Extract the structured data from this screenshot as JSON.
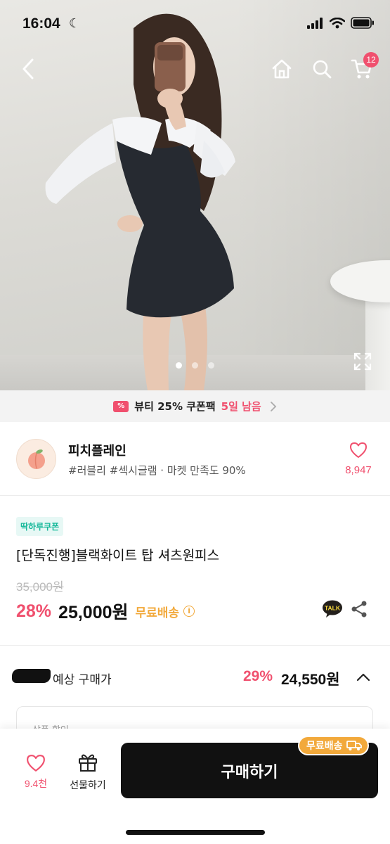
{
  "status_bar": {
    "time": "16:04",
    "moon_icon": "moon-icon",
    "signal_icon": "cellular-signal-icon",
    "wifi_icon": "wifi-icon",
    "battery_icon": "battery-icon"
  },
  "nav": {
    "back_icon": "back-chevron-icon",
    "home_icon": "home-icon",
    "search_icon": "search-icon",
    "cart_icon": "cart-icon",
    "cart_count": "12"
  },
  "gallery": {
    "image_count": 3,
    "active_index": 0,
    "expand_icon": "expand-icon"
  },
  "coupon_strip": {
    "text": "뷰티 25% 쿠폰팩",
    "deadline": "5일 남음",
    "icon": "coupon-icon"
  },
  "shop": {
    "name": "피치플레인",
    "tags": "#러블리 #섹시글램 · 마켓 만족도 90%",
    "like_count": "8,947"
  },
  "product": {
    "promo_badge": "딱하루쿠폰",
    "title": "[단독진행]블랙화이트 탑 셔츠원피스",
    "original_price": "35,000원",
    "discount": "28%",
    "sale_price": "25,000원",
    "free_shipping": "무료배송",
    "talk_label": "TALK"
  },
  "expected_price": {
    "label": "예상 구매가",
    "discount": "29%",
    "price": "24,550원"
  },
  "detail_card": {
    "label": "상품 할인"
  },
  "bottom_bar": {
    "like_count": "9.4천",
    "gift_label": "선물하기",
    "buy_label": "구매하기",
    "shipping_bubble": "무료배송"
  },
  "colors": {
    "accent_pink": "#f0506e",
    "shipping_orange": "#f2a93b",
    "badge_mint": "#17b89a",
    "buy_button": "#111111"
  }
}
